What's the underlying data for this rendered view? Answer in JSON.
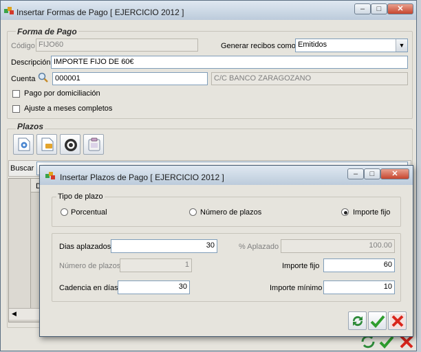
{
  "main_window": {
    "title": "Insertar Formas de Pago [ EJERCICIO 2012 ]",
    "forma_de_pago": {
      "section_title": "Forma de Pago",
      "codigo_label": "Código",
      "codigo_value": "FIJO60",
      "generar_label": "Generar recibos como",
      "generar_value": "Emitidos",
      "descripcion_label": "Descripción",
      "descripcion_value": "IMPORTE FIJO DE 60€",
      "cuenta_label": "Cuenta",
      "cuenta_value": "000001",
      "cuenta_name": "C/C BANCO ZARAGOZANO",
      "domiciliacion_label": "Pago por domiciliación",
      "ajuste_label": "Ajuste a meses completos"
    },
    "plazos": {
      "section_title": "Plazos",
      "toolbar_icons": [
        "new-icon",
        "edit-icon",
        "delete-icon",
        "clipboard-icon"
      ],
      "buscar_label": "Buscar",
      "grid_col_partial": "D"
    }
  },
  "dialog": {
    "title": "Insertar Plazos de Pago [ EJERCICIO 2012 ]",
    "tipo_de_plazo": {
      "legend": "Tipo de plazo",
      "options": [
        "Porcentual",
        "Número de plazos",
        "Importe fijo"
      ],
      "selected": "Importe fijo"
    },
    "dias_aplazados_label": "Dias aplazados",
    "dias_aplazados_value": "30",
    "pct_aplazado_label": "% Aplazado",
    "pct_aplazado_value": "100.00",
    "numero_plazos_label": "Número de plazos",
    "numero_plazos_value": "1",
    "importe_fijo_label": "Importe fijo",
    "importe_fijo_value": "60",
    "cadencia_label": "Cadencia en días",
    "cadencia_value": "30",
    "importe_minimo_label": "Importe mínimo",
    "importe_minimo_value": "10"
  },
  "colors": {
    "window_bg": "#e6e4dd",
    "titlebar": "#c8d6e5",
    "close_button": "#c6452d",
    "ok_green": "#2f9e2f",
    "cancel_red": "#d9261c"
  }
}
